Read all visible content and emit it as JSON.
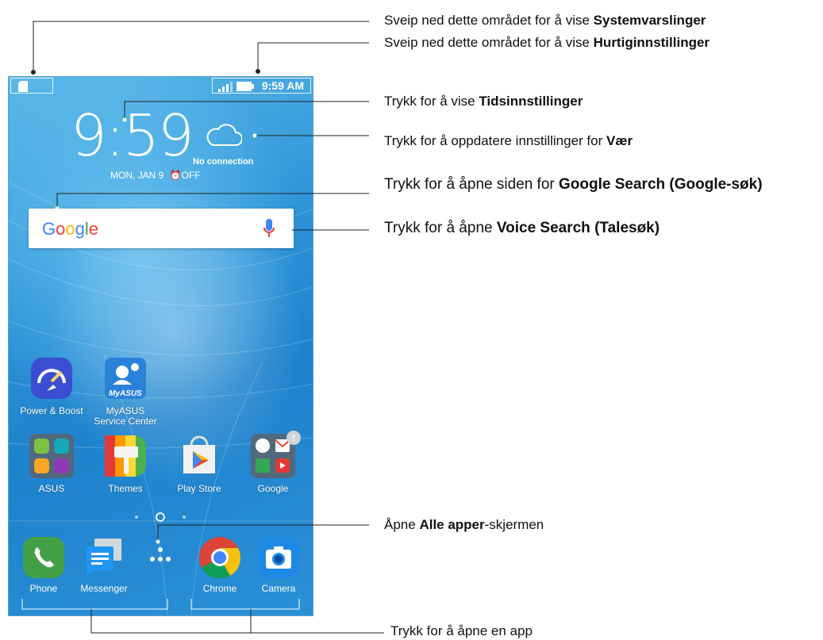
{
  "status_bar": {
    "time": "9:59 AM"
  },
  "clock": {
    "time": "9:59",
    "date": "MON, JAN 9",
    "alarm": "OFF"
  },
  "weather": {
    "status": "No connection"
  },
  "search": {
    "logo": "Google"
  },
  "apps_row1": [
    {
      "label": "Power & Boost"
    },
    {
      "label": "MyASUS Service Center",
      "icon_text": "MyASUS"
    }
  ],
  "apps_row2": [
    {
      "label": "ASUS"
    },
    {
      "label": "Themes"
    },
    {
      "label": "Play Store"
    },
    {
      "label": "Google",
      "badge": "!"
    }
  ],
  "dock": [
    {
      "label": "Phone"
    },
    {
      "label": "Messenger"
    },
    {
      "label": "All apps"
    },
    {
      "label": "Chrome"
    },
    {
      "label": "Camera"
    }
  ],
  "callouts": {
    "c1": {
      "pre": "Sveip ned dette området for å vise ",
      "bold": "Systemvarslinger",
      "post": ""
    },
    "c2": {
      "pre": "Sveip ned dette området for å vise ",
      "bold": "Hurtiginnstillinger",
      "post": ""
    },
    "c3": {
      "pre": "Trykk for å vise ",
      "bold": "Tidsinnstillinger",
      "post": ""
    },
    "c4": {
      "pre": "Trykk for å oppdatere innstillinger for ",
      "bold": "Vær",
      "post": ""
    },
    "c5": {
      "pre": "Trykk for å åpne siden for ",
      "bold": "Google Search (Google-søk)",
      "post": ""
    },
    "c6": {
      "pre": "Trykk for å åpne ",
      "bold": "Voice Search (Talesøk)",
      "post": ""
    },
    "c7": {
      "pre": "Åpne ",
      "bold": "Alle apper",
      "post": "-skjermen"
    },
    "c8": {
      "pre": "Trykk for å åpne en app",
      "bold": "",
      "post": ""
    }
  },
  "colors": {
    "wallpaper": "#2f95d8",
    "google_blue": "#4285f4",
    "google_red": "#ea4335",
    "google_yellow": "#fbbc05",
    "google_green": "#34a853"
  }
}
